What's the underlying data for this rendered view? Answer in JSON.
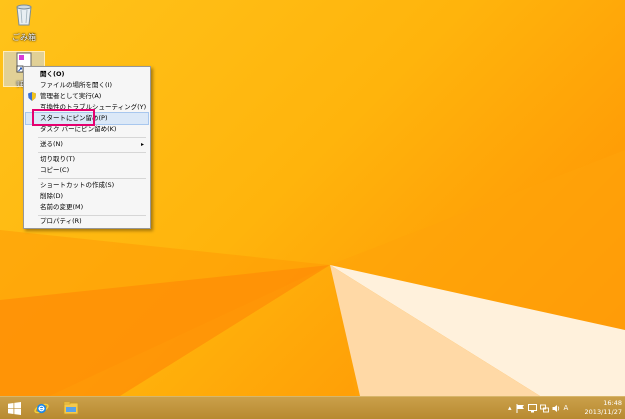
{
  "desktop": {
    "icons": [
      {
        "name": "recycle-bin",
        "label": "ごみ箱"
      },
      {
        "name": "shortcut",
        "label": "ﾘﾓｯﾌ"
      }
    ]
  },
  "context_menu": {
    "items": [
      {
        "label": "開く(O)",
        "bold": true
      },
      {
        "label": "ファイルの場所を開く(I)"
      },
      {
        "label": "管理者として実行(A)",
        "icon": "shield-icon"
      },
      {
        "label": "互換性のトラブルシューティング(Y)"
      },
      {
        "label": "スタートにピン留め(P)",
        "highlighted": true
      },
      {
        "label": "タスク バーにピン留め(K)"
      },
      {
        "label": "送る(N)",
        "submenu": true
      },
      {
        "label": "切り取り(T)"
      },
      {
        "label": "コピー(C)"
      },
      {
        "label": "ショートカットの作成(S)"
      },
      {
        "label": "削除(D)"
      },
      {
        "label": "名前の変更(M)"
      },
      {
        "label": "プロパティ(R)"
      }
    ],
    "submenu_arrow": "▸"
  },
  "taskbar": {
    "tray_up_arrow": "▴",
    "ime": "A",
    "clock_time": "16:48",
    "clock_date": "2013/11/27"
  },
  "colors": {
    "accent_highlight": "#dbe8f7",
    "annotation_box": "#e5006f",
    "desktop_bg": "#ffb40c"
  }
}
